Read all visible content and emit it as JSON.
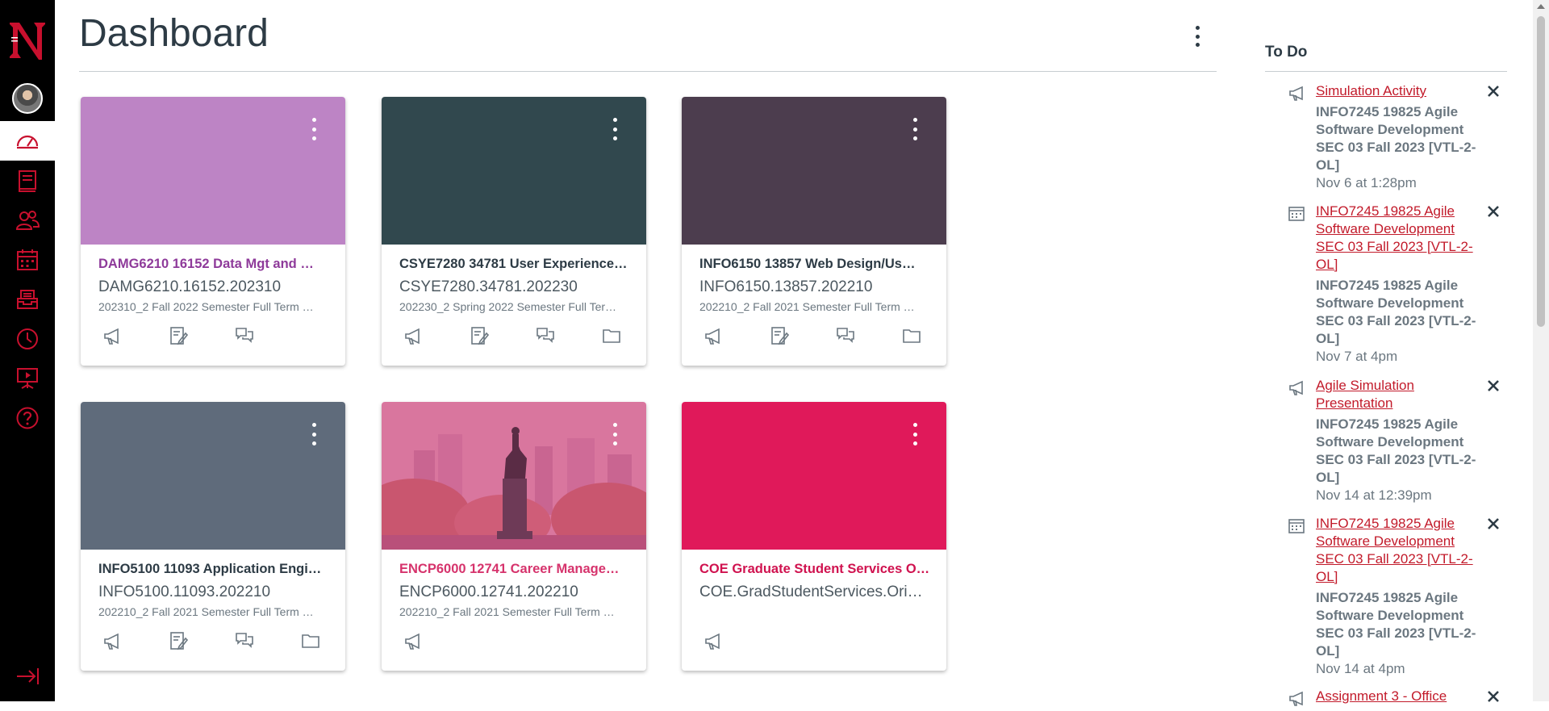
{
  "colors": {
    "brand": "#c8102e",
    "nav_bg": "#000000",
    "link": "#c21a2a"
  },
  "nav": {
    "logo": "northeastern-logo",
    "avatar": "user-avatar",
    "items": [
      "dashboard-icon",
      "courses-icon",
      "groups-icon",
      "calendar-icon",
      "inbox-icon",
      "history-icon",
      "studio-icon",
      "help-icon"
    ],
    "collapse": "collapse-nav-icon"
  },
  "header": {
    "title": "Dashboard"
  },
  "cards": [
    {
      "name": "DAMG6210 16152 Data Mgt and …",
      "code": "DAMG6210.16152.202310",
      "term": "202310_2 Fall 2022 Semester Full Term …",
      "color": "#bd84c5",
      "name_color": "#8e3a9a",
      "image": false,
      "icons": [
        "announcements-icon",
        "assignments-icon",
        "discussions-icon"
      ]
    },
    {
      "name": "CSYE7280 34781 User Experience…",
      "code": "CSYE7280.34781.202230",
      "term": "202230_2 Spring 2022 Semester Full Ter…",
      "color": "#31484e",
      "name_color": "#2d3b45",
      "image": false,
      "icons": [
        "announcements-icon",
        "assignments-icon",
        "discussions-icon",
        "files-icon"
      ]
    },
    {
      "name": "INFO6150 13857 Web Design/Us…",
      "code": "INFO6150.13857.202210",
      "term": "202210_2 Fall 2021 Semester Full Term …",
      "color": "#4c3d4e",
      "name_color": "#2d3b45",
      "image": false,
      "icons": [
        "announcements-icon",
        "assignments-icon",
        "discussions-icon",
        "files-icon"
      ]
    },
    {
      "name": "INFO5100 11093 Application Engi…",
      "code": "INFO5100.11093.202210",
      "term": "202210_2 Fall 2021 Semester Full Term …",
      "color": "#5f6b7b",
      "name_color": "#2d3b45",
      "image": false,
      "icons": [
        "announcements-icon",
        "assignments-icon",
        "discussions-icon",
        "files-icon"
      ]
    },
    {
      "name": "ENCP6000 12741 Career Manage…",
      "code": "ENCP6000.12741.202210",
      "term": "202210_2 Fall 2021 Semester Full Term …",
      "color": "#d2548f",
      "name_color": "#d6336c",
      "image": true,
      "icons": [
        "announcements-icon"
      ]
    },
    {
      "name": "COE Graduate Student Services O…",
      "code": "COE.GradStudentServices.Ori…",
      "term": "",
      "color": "#e0195a",
      "name_color": "#d0124f",
      "image": false,
      "icons": [
        "announcements-icon"
      ]
    }
  ],
  "todo": {
    "title": "To Do",
    "items": [
      {
        "icon": "announcement-icon",
        "title": "Simulation Activity",
        "course": "INFO7245 19825 Agile Software Development SEC 03 Fall 2023 [VTL-2-OL]",
        "date": "Nov 6 at 1:28pm"
      },
      {
        "icon": "calendar-event-icon",
        "title": "INFO7245 19825 Agile Software Development SEC 03 Fall 2023 [VTL-2-OL]",
        "course": "INFO7245 19825 Agile Software Development SEC 03 Fall 2023 [VTL-2-OL]",
        "date": "Nov 7 at 4pm"
      },
      {
        "icon": "announcement-icon",
        "title": "Agile Simulation Presentation",
        "course": "INFO7245 19825 Agile Software Development SEC 03 Fall 2023 [VTL-2-OL]",
        "date": "Nov 14 at 12:39pm"
      },
      {
        "icon": "calendar-event-icon",
        "title": "INFO7245 19825 Agile Software Development SEC 03 Fall 2023 [VTL-2-OL]",
        "course": "INFO7245 19825 Agile Software Development SEC 03 Fall 2023 [VTL-2-OL]",
        "date": "Nov 14 at 4pm"
      },
      {
        "icon": "announcement-icon",
        "title": "Assignment 3 - Office",
        "course": "",
        "date": ""
      }
    ]
  }
}
